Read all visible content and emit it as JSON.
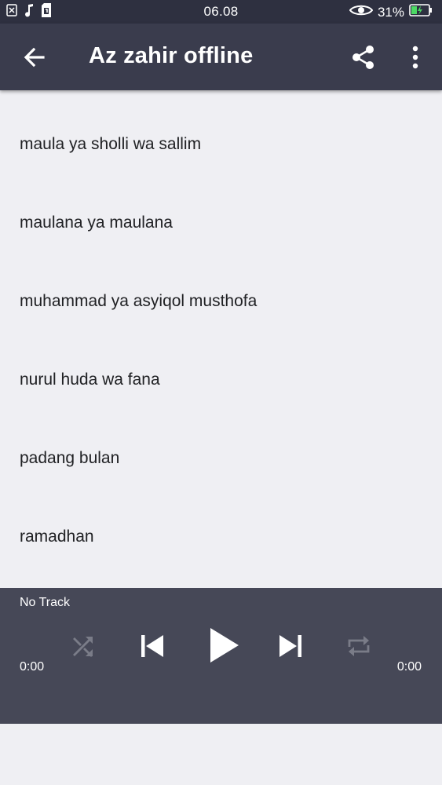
{
  "status_bar": {
    "time": "06.08",
    "battery_percent": "31%",
    "icons": [
      "close-box-icon",
      "music-note-icon",
      "sim-icon",
      "eye-icon",
      "battery-charging-icon"
    ]
  },
  "app_bar": {
    "title": "Az zahir offline",
    "icons": [
      "back-arrow-icon",
      "share-icon",
      "more-vert-icon"
    ]
  },
  "tracks": [
    {
      "label": "maula ya sholli wa sallim"
    },
    {
      "label": "maulana ya maulana"
    },
    {
      "label": "muhammad ya asyiqol musthofa"
    },
    {
      "label": "nurul huda wa fana"
    },
    {
      "label": "padang bulan"
    },
    {
      "label": "ramadhan"
    }
  ],
  "player": {
    "now_playing": "No Track",
    "elapsed": "0:00",
    "total": "0:00",
    "icons": [
      "shuffle-icon",
      "skip-previous-icon",
      "play-icon",
      "skip-next-icon",
      "repeat-icon"
    ],
    "colors": {
      "background": "#464857",
      "active_icon": "#ffffff",
      "inactive_icon": "#7a7c88"
    }
  },
  "colors": {
    "status_bar": "#2e3040",
    "app_bar": "#3a3c4d",
    "list_background": "#efeff3",
    "list_text": "#202124"
  }
}
